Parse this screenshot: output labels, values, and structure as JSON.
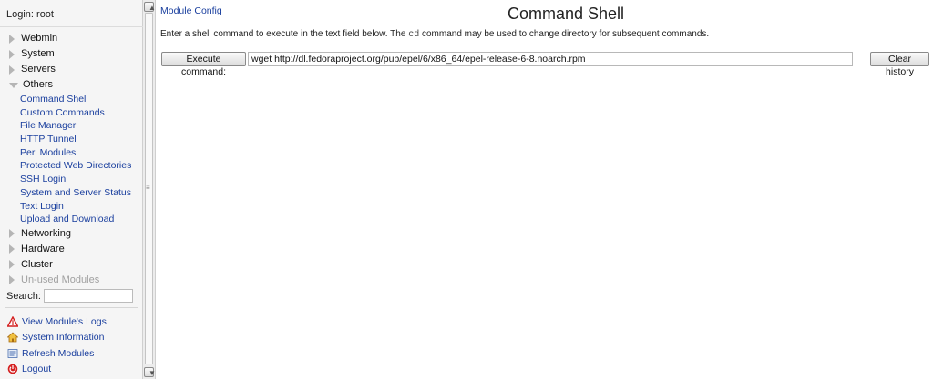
{
  "sidebar": {
    "login": "Login: root",
    "categories_top": [
      {
        "label": "Webmin"
      },
      {
        "label": "System"
      },
      {
        "label": "Servers"
      }
    ],
    "open_category": {
      "label": "Others",
      "items": [
        "Command Shell",
        "Custom Commands",
        "File Manager",
        "HTTP Tunnel",
        "Perl Modules",
        "Protected Web Directories",
        "SSH Login",
        "System and Server Status",
        "Text Login",
        "Upload and Download"
      ]
    },
    "categories_bottom": [
      {
        "label": "Networking"
      },
      {
        "label": "Hardware"
      },
      {
        "label": "Cluster"
      }
    ],
    "unused": "Un-used Modules",
    "search_label": "Search:",
    "search_value": "",
    "links": [
      {
        "label": "View Module's Logs",
        "icon": "warning-icon"
      },
      {
        "label": "System Information",
        "icon": "home-icon"
      },
      {
        "label": "Refresh Modules",
        "icon": "refresh-icon"
      },
      {
        "label": "Logout",
        "icon": "logout-icon"
      }
    ]
  },
  "main": {
    "module_config": "Module Config",
    "title": "Command Shell",
    "description_before": "Enter a shell command to execute in the text field below. The ",
    "description_code": "cd",
    "description_after": " command may be used to change directory for subsequent commands.",
    "execute_label": "Execute command:",
    "command_value": "wget http://dl.fedoraproject.org/pub/epel/6/x86_64/epel-release-6-8.noarch.rpm",
    "clear_label": "Clear history"
  },
  "colors": {
    "link": "#1a3f9e",
    "sidebar_bg": "#f5f5f5"
  }
}
